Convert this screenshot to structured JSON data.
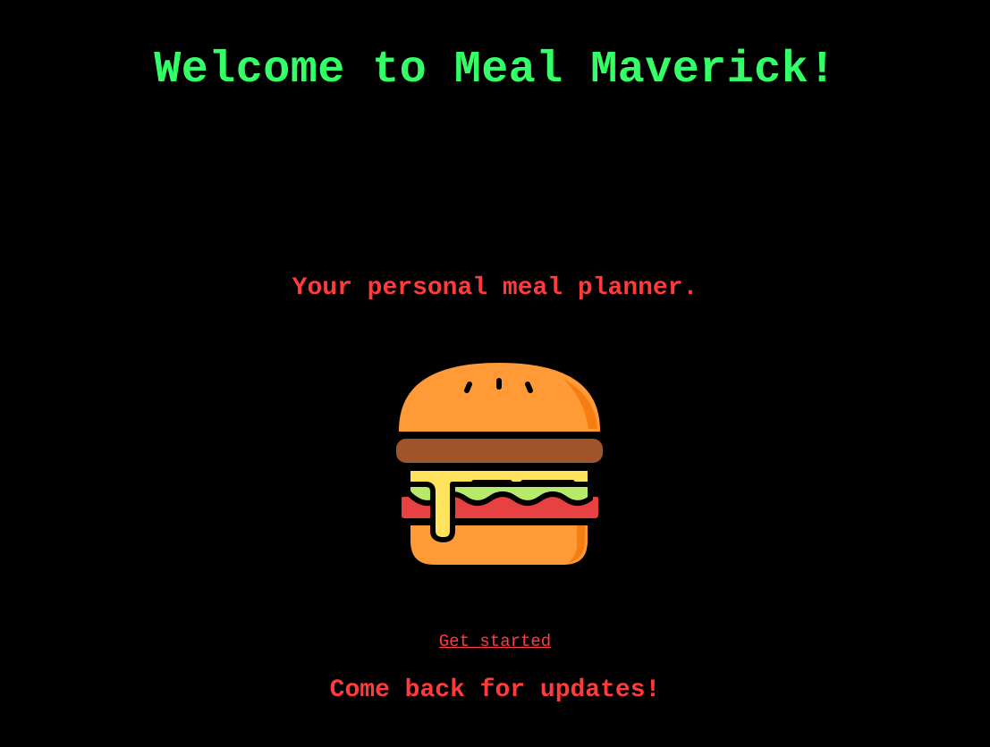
{
  "header": {
    "title": "Welcome to Meal Maverick!"
  },
  "main": {
    "tagline": "Your personal meal planner.",
    "hero_icon": "burger-icon",
    "cta_link": "Get started",
    "footer_note": "Come back for updates!"
  },
  "colors": {
    "background": "#000000",
    "title": "#33ff66",
    "accent_red": "#ff3b3b",
    "bun": "#ff9a36",
    "bun_shade": "#f57d12",
    "patty": "#a0542a",
    "cheese": "#ffe35c",
    "lettuce": "#b7ea6a",
    "tomato": "#e84141",
    "outline": "#000000"
  }
}
